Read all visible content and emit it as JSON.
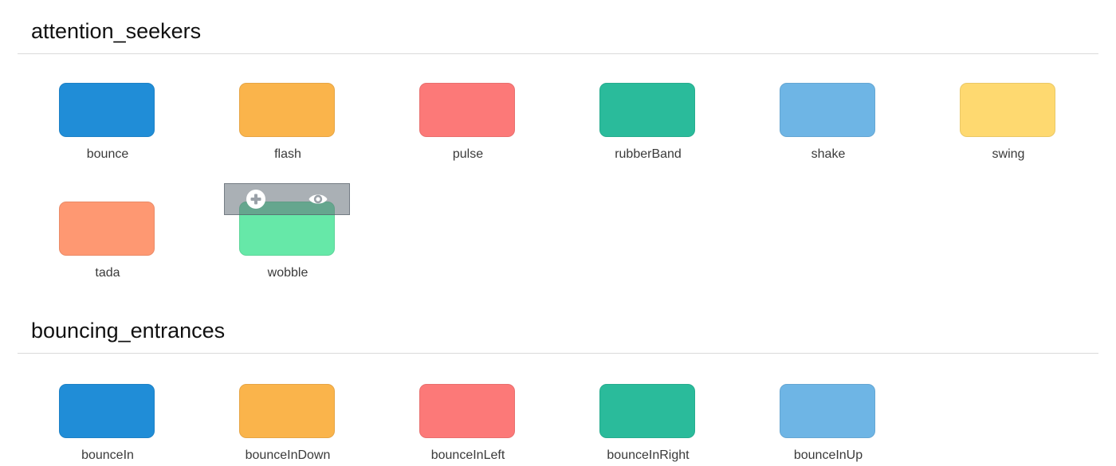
{
  "sections": [
    {
      "title": "attention_seekers",
      "items": [
        {
          "label": "bounce",
          "color": "#208dd7"
        },
        {
          "label": "flash",
          "color": "#fab44b"
        },
        {
          "label": "pulse",
          "color": "#fc7978"
        },
        {
          "label": "rubberBand",
          "color": "#2abb9b"
        },
        {
          "label": "shake",
          "color": "#6eb5e5"
        },
        {
          "label": "swing",
          "color": "#fed970"
        },
        {
          "label": "tada",
          "color": "#fe9872"
        },
        {
          "label": "wobble",
          "color": "#66e8a8"
        }
      ]
    },
    {
      "title": "bouncing_entrances",
      "items": [
        {
          "label": "bounceIn",
          "color": "#208dd7"
        },
        {
          "label": "bounceInDown",
          "color": "#fab44b"
        },
        {
          "label": "bounceInLeft",
          "color": "#fc7978"
        },
        {
          "label": "bounceInRight",
          "color": "#2abb9b"
        },
        {
          "label": "bounceInUp",
          "color": "#6eb5e5"
        }
      ]
    }
  ],
  "hover_overlay": {
    "target": "wobble",
    "actions": [
      {
        "icon": "plus-circle-icon"
      },
      {
        "icon": "eye-icon"
      }
    ]
  }
}
